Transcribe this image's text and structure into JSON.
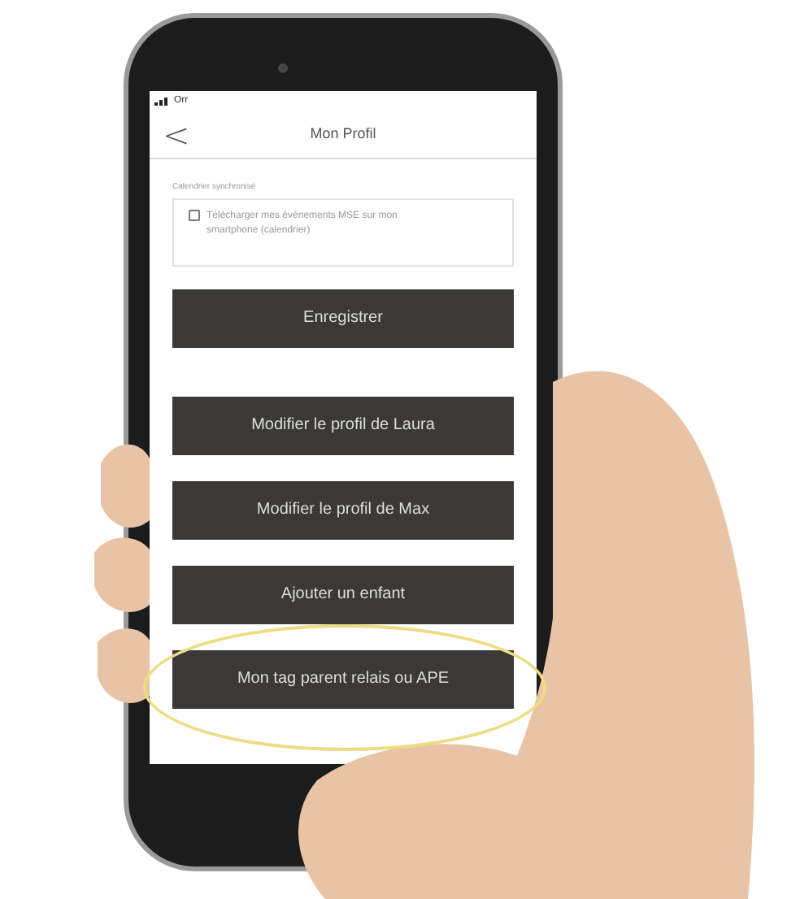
{
  "status_bar": {
    "carrier": "Orr"
  },
  "header": {
    "back": "<",
    "title": "Mon Profil"
  },
  "calendar": {
    "label": "Calendrier synchronisé",
    "option": {
      "text": "Télécharger mes évènements MSE sur mon smartphone (calendrier)",
      "checked": false
    }
  },
  "save_button": "Enregistrer",
  "buttons": [
    {
      "label": "Modifier le profil de Laura",
      "highlighted": false
    },
    {
      "label": "Modifier le profil de Max",
      "highlighted": false
    },
    {
      "label": "Ajouter un enfant",
      "highlighted": false
    },
    {
      "label": "Mon tag parent relais ou APE",
      "highlighted": true
    }
  ]
}
